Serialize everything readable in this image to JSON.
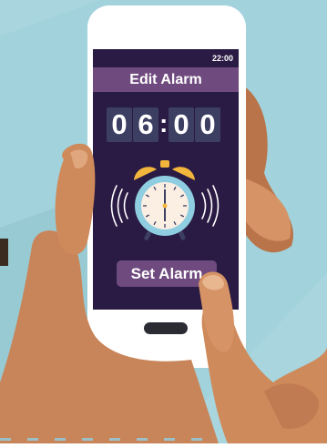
{
  "status_bar": {
    "time": "22:00"
  },
  "header": {
    "title": "Edit Alarm"
  },
  "alarm_time": {
    "hour_tens": "0",
    "hour_ones": "6",
    "separator": ":",
    "minute_tens": "0",
    "minute_ones": "0"
  },
  "actions": {
    "set_alarm_label": "Set Alarm"
  },
  "colors": {
    "background": "#a8d5de",
    "phone_body": "#ffffff",
    "screen_bg": "#2a1b44",
    "header_bar": "#6f4a7e",
    "digit_tile": "#3c3f62",
    "clock_bell": "#f3b63c",
    "clock_ring": "#8fcde0",
    "skin": "#cf8a5b"
  },
  "icons": [
    "alarm-clock-icon",
    "ringing-waves-icon",
    "home-button-icon"
  ]
}
